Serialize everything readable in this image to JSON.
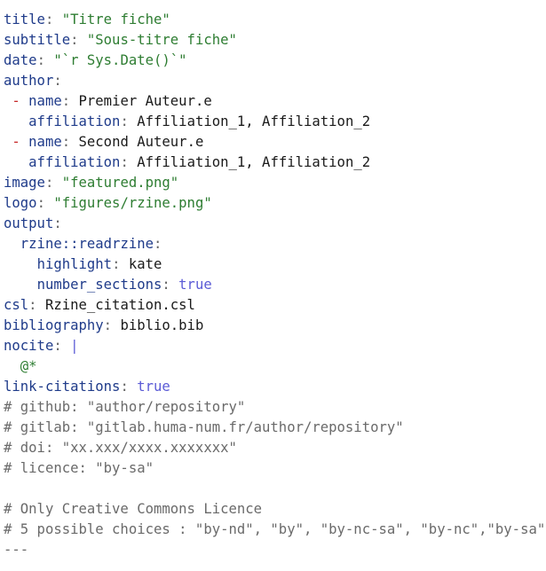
{
  "lines": [
    {
      "type": "fence",
      "text": "---"
    },
    {
      "type": "kv",
      "indent": "",
      "key": "title",
      "value": "\"Titre fiche\"",
      "vtype": "str"
    },
    {
      "type": "kv",
      "indent": "",
      "key": "subtitle",
      "value": "\"Sous-titre fiche\"",
      "vtype": "str"
    },
    {
      "type": "kv",
      "indent": "",
      "key": "date",
      "value": "\"`r Sys.Date()`\"",
      "vtype": "str"
    },
    {
      "type": "kv",
      "indent": "",
      "key": "author",
      "value": "",
      "vtype": "plain"
    },
    {
      "type": "listkv",
      "indent": " ",
      "dash": "-",
      "key": "name",
      "value": "Premier Auteur.e",
      "vtype": "plain"
    },
    {
      "type": "kv",
      "indent": "   ",
      "key": "affiliation",
      "value": "Affiliation_1, Affiliation_2",
      "vtype": "plain"
    },
    {
      "type": "listkv",
      "indent": " ",
      "dash": "-",
      "key": "name",
      "value": "Second Auteur.e",
      "vtype": "plain"
    },
    {
      "type": "kv",
      "indent": "   ",
      "key": "affiliation",
      "value": "Affiliation_1, Affiliation_2",
      "vtype": "plain"
    },
    {
      "type": "kv",
      "indent": "",
      "key": "image",
      "value": "\"featured.png\"",
      "vtype": "str"
    },
    {
      "type": "kv",
      "indent": "",
      "key": "logo",
      "value": "\"figures/rzine.png\"",
      "vtype": "str"
    },
    {
      "type": "kv",
      "indent": "",
      "key": "output",
      "value": "",
      "vtype": "plain"
    },
    {
      "type": "kv",
      "indent": "  ",
      "key": "rzine::readrzine",
      "value": "",
      "vtype": "plain"
    },
    {
      "type": "kv",
      "indent": "    ",
      "key": "highlight",
      "value": "kate",
      "vtype": "plain"
    },
    {
      "type": "kv",
      "indent": "    ",
      "key": "number_sections",
      "value": "true",
      "vtype": "bool"
    },
    {
      "type": "kv",
      "indent": "",
      "key": "csl",
      "value": "Rzine_citation.csl",
      "vtype": "plain"
    },
    {
      "type": "kv",
      "indent": "",
      "key": "bibliography",
      "value": "biblio.bib",
      "vtype": "plain"
    },
    {
      "type": "kv",
      "indent": "",
      "key": "nocite",
      "value": "|",
      "vtype": "pipe"
    },
    {
      "type": "raw",
      "indent": "  ",
      "text": "@*",
      "vtype": "at"
    },
    {
      "type": "kv",
      "indent": "",
      "key": "link-citations",
      "value": "true",
      "vtype": "bool"
    },
    {
      "type": "comment",
      "text": "# github: \"author/repository\""
    },
    {
      "type": "comment",
      "text": "# gitlab: \"gitlab.huma-num.fr/author/repository\""
    },
    {
      "type": "comment",
      "text": "# doi: \"xx.xxx/xxxx.xxxxxxx\""
    },
    {
      "type": "comment",
      "text": "# licence: \"by-sa\""
    },
    {
      "type": "blank",
      "text": ""
    },
    {
      "type": "comment",
      "text": "# Only Creative Commons Licence"
    },
    {
      "type": "comment",
      "text": "# 5 possible choices : \"by-nd\", \"by\", \"by-nc-sa\", \"by-nc\",\"by-sa\""
    },
    {
      "type": "fence",
      "text": "---"
    }
  ]
}
